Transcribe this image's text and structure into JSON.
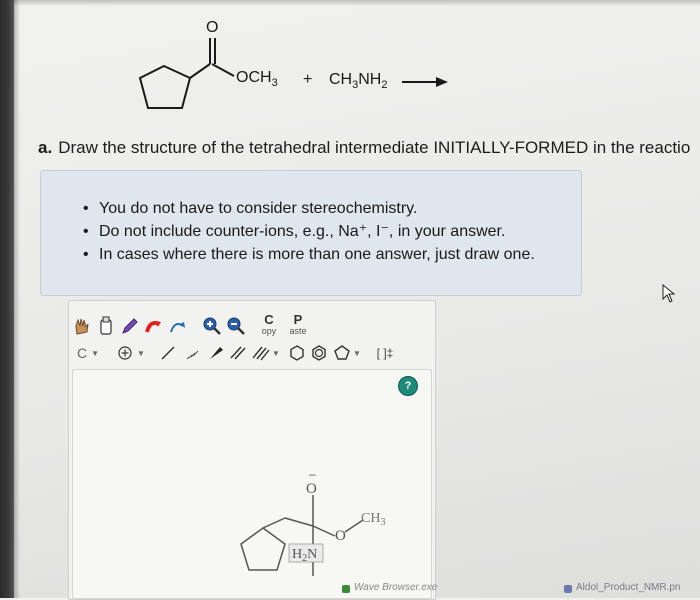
{
  "reaction": {
    "carbonyl_o": "O",
    "ester_group": "OCH",
    "ester_sub": "3",
    "plus": "+",
    "amine_main": "CH",
    "amine_sub1": "3",
    "amine_nh": "NH",
    "amine_sub2": "2"
  },
  "question": {
    "letter": "a.",
    "text": "Draw the structure of the tetrahedral intermediate INITIALLY-FORMED in the reactio"
  },
  "notes": {
    "items": [
      "You do not have to consider stereochemistry.",
      "Do not include counter-ions, e.g., Na⁺, I⁻, in your answer.",
      "In cases where there is more than one answer, just draw one."
    ]
  },
  "editor": {
    "copy_letter": "C",
    "copy_text": "opy",
    "paste_letter": "P",
    "paste_text": "aste",
    "element_selector": "C",
    "charge_label": "[ ]‡",
    "help_label": "?"
  },
  "drawing": {
    "o_top": "O",
    "o_top_charge": "–",
    "ch3": "CH",
    "ch3_sub": "3",
    "o_ester": "O",
    "nh2": "H",
    "nh2_sub": "2",
    "nh2_n": "N"
  },
  "taskbar": {
    "left_item": "Wave Browser.exe",
    "right_item": "Aldol_Product_NMR.pn"
  }
}
